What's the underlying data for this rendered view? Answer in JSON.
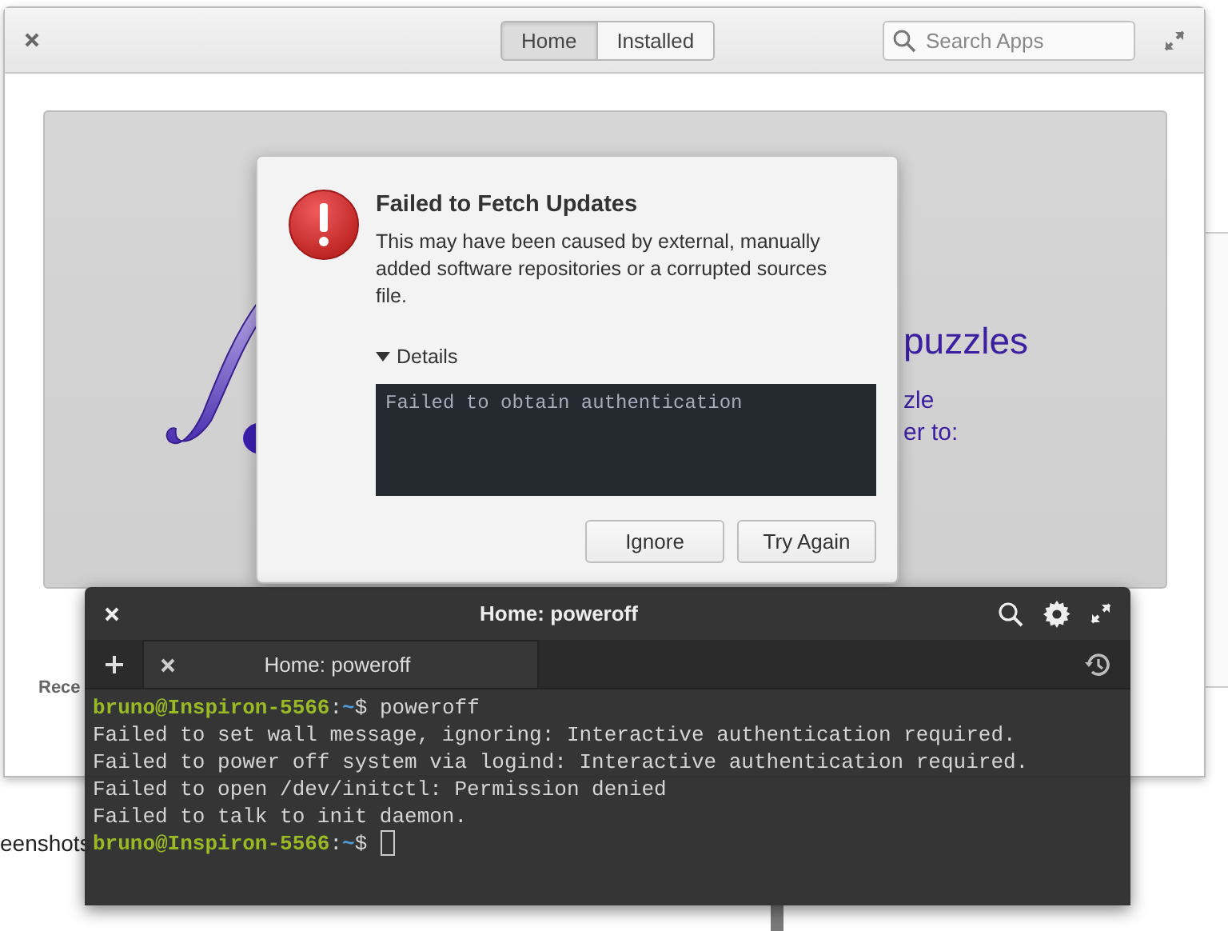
{
  "appcenter": {
    "tabs": [
      {
        "label": "Home",
        "selected": true
      },
      {
        "label": "Installed",
        "selected": false
      }
    ],
    "search": {
      "placeholder": "Search Apps"
    },
    "banner": {
      "heading": "puzzles",
      "lines": [
        "zle",
        "er to:"
      ]
    },
    "section_title": "Rece"
  },
  "dialog": {
    "title": "Failed to Fetch Updates",
    "message": "This may have been caused by external, manually added software repositories or a corrupted sources file.",
    "details": {
      "label": "Details",
      "expanded": true,
      "text": "Failed to obtain authentication"
    },
    "buttons": [
      "Ignore",
      "Try Again"
    ]
  },
  "terminal": {
    "title": "Home: poweroff",
    "tabs": [
      {
        "label": "Home: poweroff",
        "selected": true
      }
    ],
    "lines": [
      {
        "kind": "prompt",
        "user_host": "bruno@Inspiron-5566",
        "colon": ":",
        "path": "~",
        "dollar": "$",
        "command": "poweroff"
      },
      {
        "kind": "output",
        "text": "Failed to set wall message, ignoring: Interactive authentication required."
      },
      {
        "kind": "output",
        "text": "Failed to power off system via logind: Interactive authentication required."
      },
      {
        "kind": "output",
        "text": "Failed to open /dev/initctl: Permission denied"
      },
      {
        "kind": "output",
        "text": "Failed to talk to init daemon."
      },
      {
        "kind": "prompt",
        "user_host": "bruno@Inspiron-5566",
        "colon": ":",
        "path": "~",
        "dollar": "$",
        "cursor": true
      }
    ]
  },
  "background": {
    "text": "eenshots"
  }
}
